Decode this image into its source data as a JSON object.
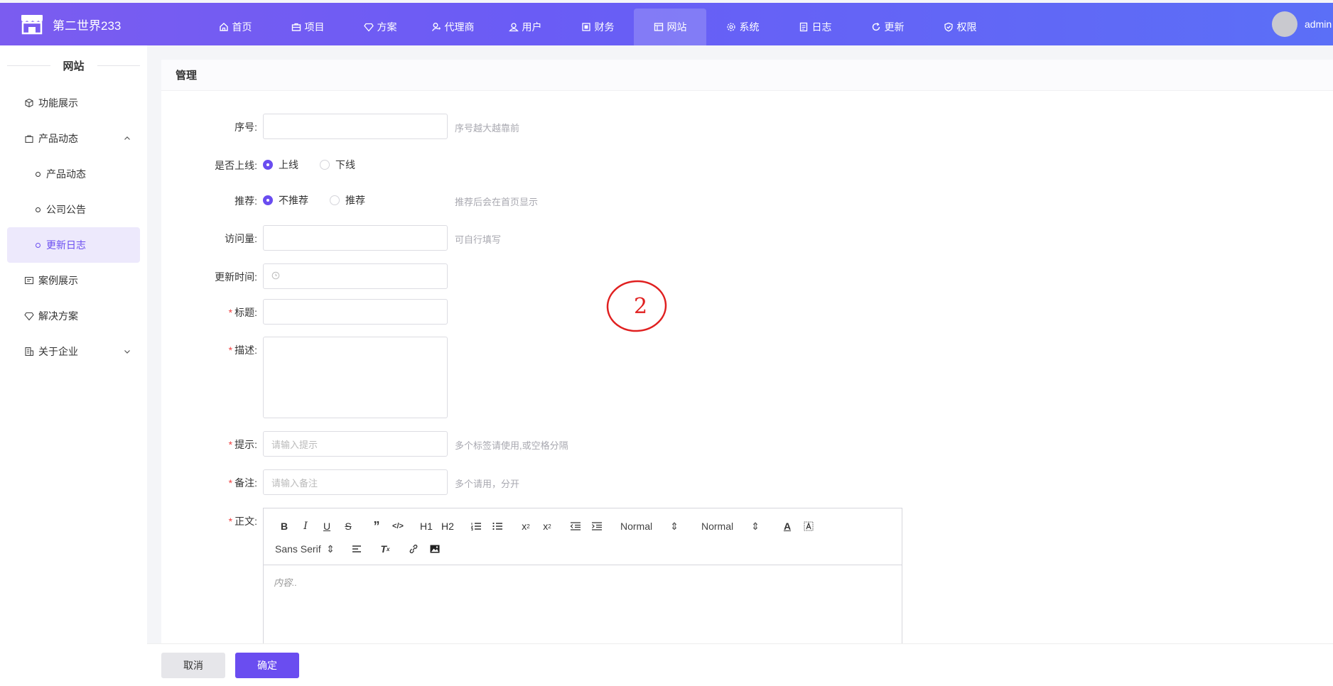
{
  "app": {
    "title": "第二世界233"
  },
  "nav": [
    {
      "label": "首页",
      "icon": "home-icon"
    },
    {
      "label": "项目",
      "icon": "briefcase-icon"
    },
    {
      "label": "方案",
      "icon": "diamond-icon"
    },
    {
      "label": "代理商",
      "icon": "agent-icon"
    },
    {
      "label": "用户",
      "icon": "users-icon"
    },
    {
      "label": "财务",
      "icon": "finance-icon"
    },
    {
      "label": "网站",
      "icon": "website-icon",
      "active": true
    },
    {
      "label": "系统",
      "icon": "gear-icon"
    },
    {
      "label": "日志",
      "icon": "log-icon"
    },
    {
      "label": "更新",
      "icon": "refresh-icon"
    },
    {
      "label": "权限",
      "icon": "shield-icon"
    }
  ],
  "user": {
    "name": "admin"
  },
  "sidebar": {
    "title": "网站",
    "items": [
      {
        "label": "功能展示",
        "icon": "cube-icon"
      },
      {
        "label": "产品动态",
        "icon": "bag-icon",
        "expanded": true,
        "children": [
          {
            "label": "产品动态"
          },
          {
            "label": "公司公告"
          },
          {
            "label": "更新日志",
            "active": true
          }
        ]
      },
      {
        "label": "案例展示",
        "icon": "case-icon"
      },
      {
        "label": "解决方案",
        "icon": "diamond-icon"
      },
      {
        "label": "关于企业",
        "icon": "building-icon"
      }
    ]
  },
  "panel": {
    "title": "管理"
  },
  "form": {
    "order": {
      "label": "序号:",
      "hint": "序号越大越靠前"
    },
    "online": {
      "label": "是否上线:",
      "options": [
        "上线",
        "下线"
      ],
      "selected": "上线"
    },
    "recommend": {
      "label": "推荐:",
      "options": [
        "不推荐",
        "推荐"
      ],
      "selected": "不推荐",
      "hint": "推荐后会在首页显示"
    },
    "views": {
      "label": "访问量:",
      "hint": "可自行填写"
    },
    "update_time": {
      "label": "更新时间:"
    },
    "title": {
      "label": "标题:",
      "required": "*"
    },
    "desc": {
      "label": "描述:",
      "required": "*"
    },
    "tips": {
      "label": "提示:",
      "required": "*",
      "placeholder": "请输入提示",
      "hint": "多个标签请使用,或空格分隔"
    },
    "remark": {
      "label": "备注:",
      "required": "*",
      "placeholder": "请输入备注",
      "hint": "多个请用，分开"
    },
    "body": {
      "label": "正文:",
      "required": "*"
    }
  },
  "editor": {
    "header_select": "Normal",
    "size_select": "Normal",
    "font_select": "Sans Serif",
    "placeholder": "内容..",
    "h1": "H1",
    "h2": "H2"
  },
  "footer": {
    "cancel": "取消",
    "confirm": "确定"
  },
  "annotation": {
    "text": "2",
    "color": "#e02020"
  }
}
